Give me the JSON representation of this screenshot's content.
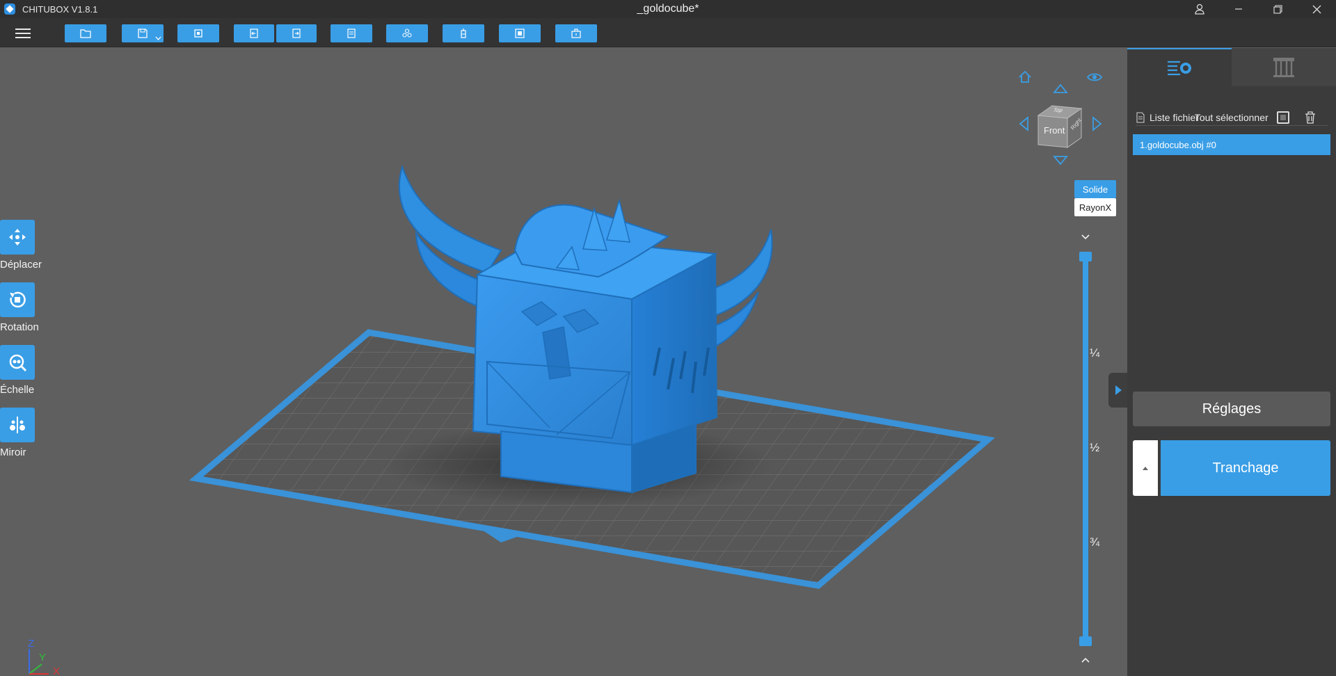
{
  "app": {
    "name": "CHITUBOX V1.8.1",
    "document_title": "_goldocube*"
  },
  "window_controls": {
    "user": "user-icon",
    "minimize": "—",
    "restore": "restore-icon",
    "close": "✕"
  },
  "tools": [
    {
      "label": "Déplacer",
      "icon": "move-icon"
    },
    {
      "label": "Rotation",
      "icon": "rotate-icon"
    },
    {
      "label": "Échelle",
      "icon": "scale-icon"
    },
    {
      "label": "Miroir",
      "icon": "mirror-icon"
    }
  ],
  "view": {
    "cube_front": "Front",
    "cube_top": "Top",
    "cube_right": "Right",
    "render_solid": "Solide",
    "render_xray": "RayonX"
  },
  "slider": {
    "marks": [
      "¼",
      "½",
      "¾"
    ]
  },
  "axes": {
    "z": "Z",
    "y": "Y",
    "x": "X"
  },
  "panel": {
    "file_list_label": "Liste fichier",
    "select_all_label": "Tout sélectionner",
    "files": [
      "1.goldocube.obj #0"
    ],
    "settings_label": "Réglages",
    "slice_label": "Tranchage"
  },
  "colors": {
    "accent": "#3a9ee6",
    "model": "#2f8fe0",
    "background": "#5f5f5f",
    "panel": "#3b3b3b"
  }
}
